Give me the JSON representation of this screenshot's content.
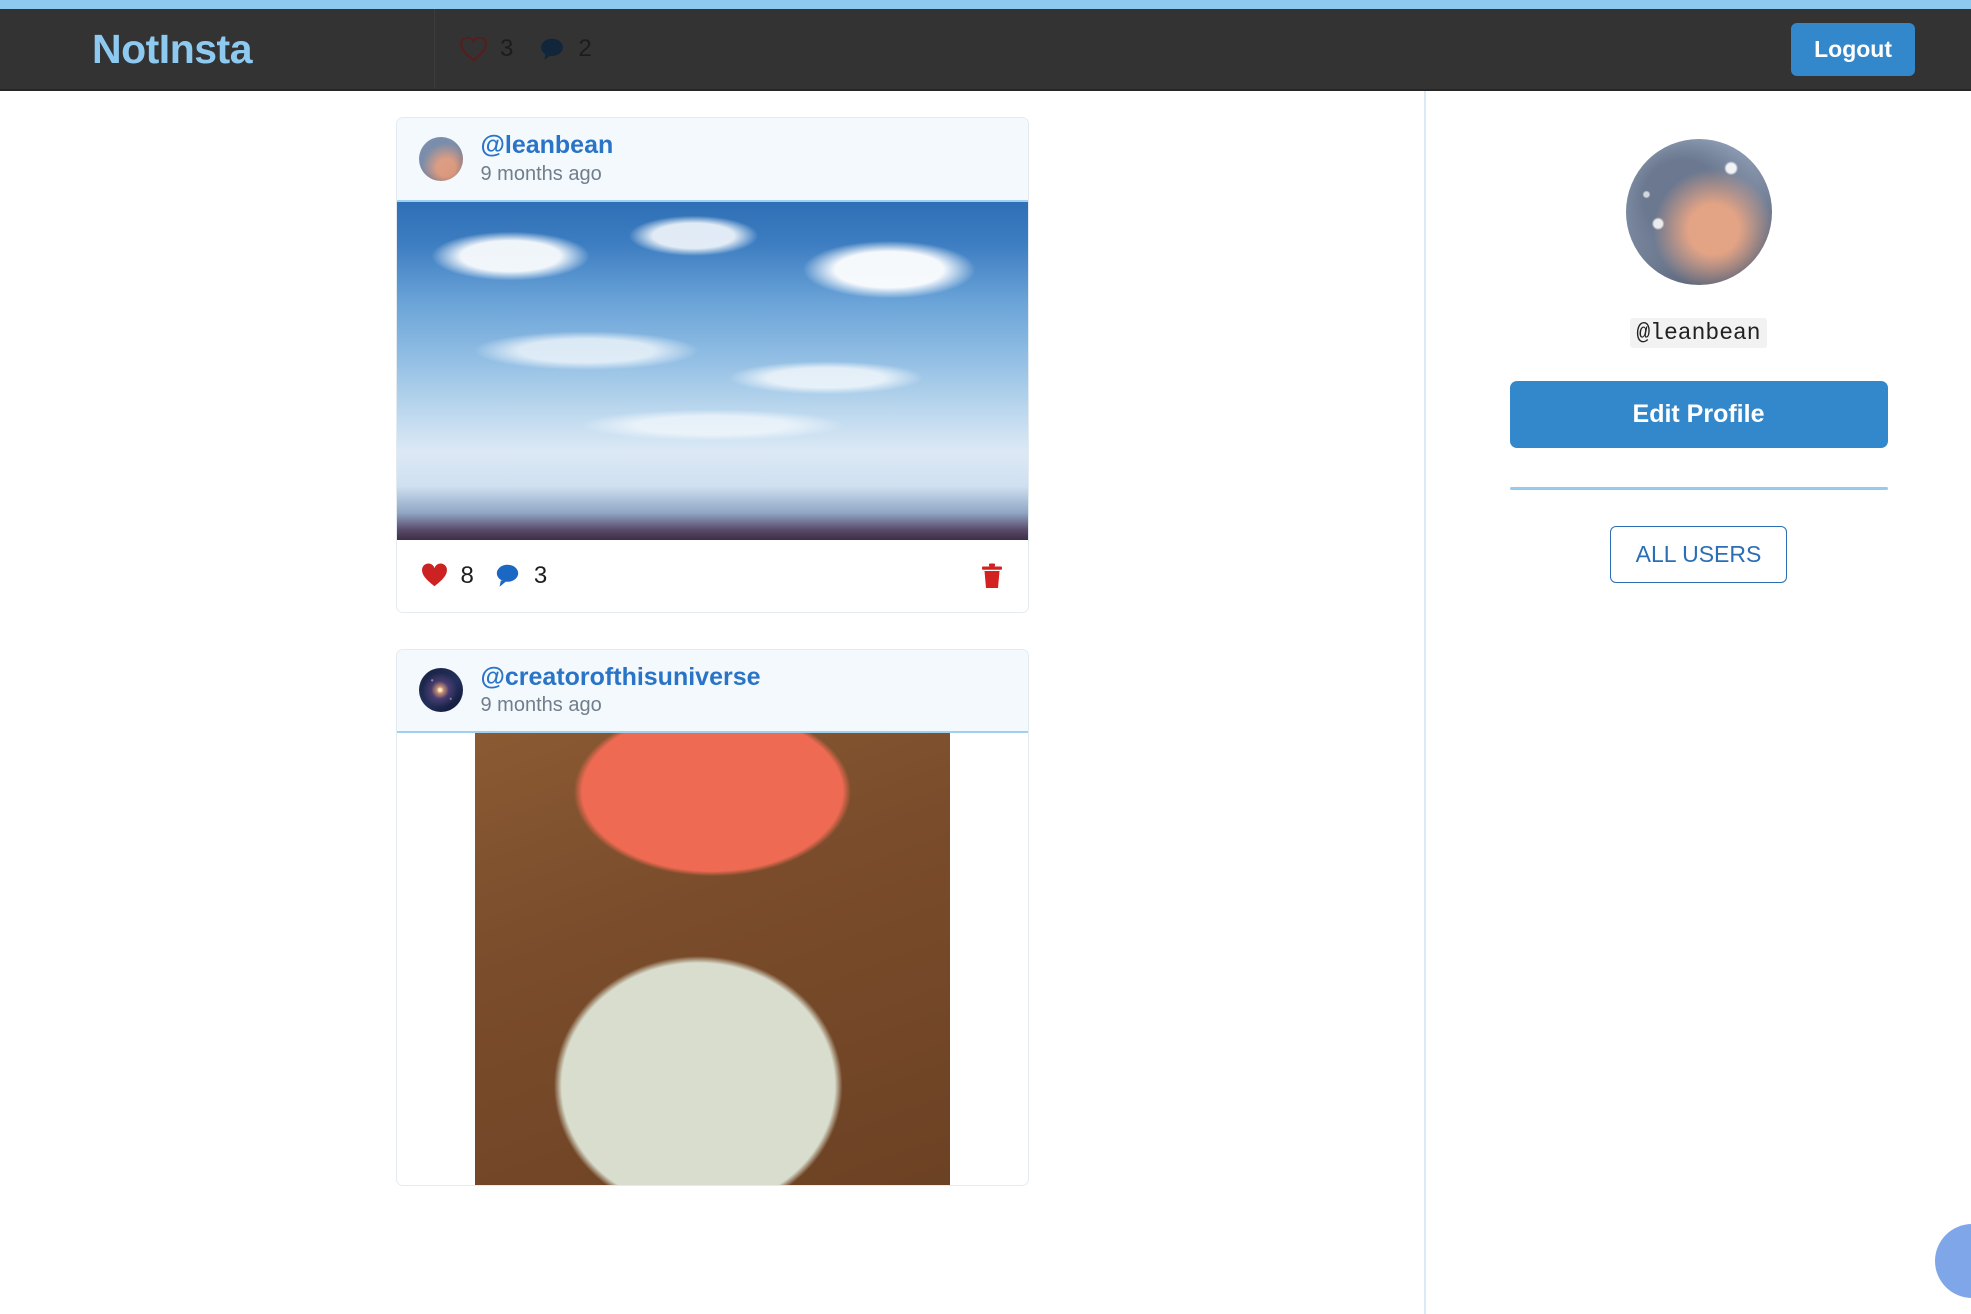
{
  "theme": {
    "accent_blue": "#3388cc",
    "light_blue": "#8ECAF0",
    "navbar_bg": "#333333",
    "heart_red": "#cc2222",
    "link_blue": "#2a74c7"
  },
  "navbar": {
    "brand": "NotInsta",
    "logout_label": "Logout",
    "stats": {
      "likes_icon": "heart-outline-icon",
      "likes_count": "3",
      "comments_icon": "comment-bubble-icon",
      "comments_count": "2"
    }
  },
  "feed": {
    "posts": [
      {
        "username": "@leanbean",
        "time": "9 months ago",
        "avatar": "sky-clouds-avatar",
        "media": "blue-sky-with-clouds-photo",
        "likes": "8",
        "comments": "3",
        "delete_icon": "trash-icon"
      },
      {
        "username": "@creatorofthisuniverse",
        "time": "9 months ago",
        "avatar": "galaxy-avatar",
        "media": "tuna-tostada-food-photo",
        "likes": "",
        "comments": "",
        "delete_icon": "trash-icon"
      }
    ]
  },
  "sidebar": {
    "avatar": "sky-clouds-avatar",
    "username": "@leanbean",
    "edit_profile_label": "Edit Profile",
    "all_users_label": "ALL USERS"
  },
  "fab": {
    "name": "floating-action-button"
  }
}
